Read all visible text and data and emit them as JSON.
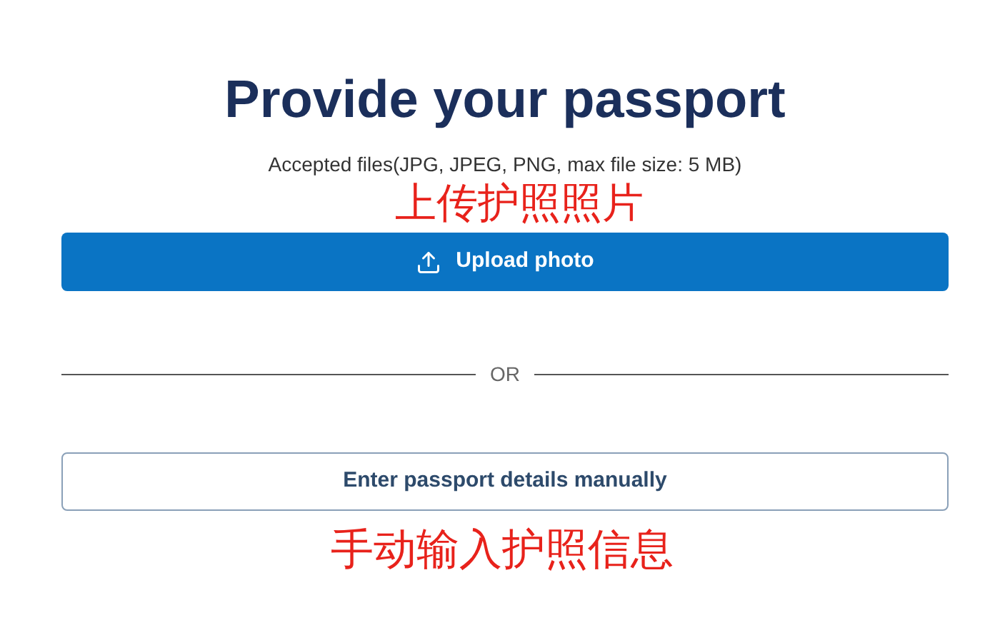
{
  "title": "Provide your passport",
  "subtitle": "Accepted files(JPG, JPEG, PNG, max file size: 5 MB)",
  "annotations": [
    "上传护照照片",
    "手动输入护照信息"
  ],
  "upload_button": {
    "label": "Upload photo"
  },
  "divider": {
    "label": "OR"
  },
  "manual_button": {
    "label": "Enter passport details manually"
  }
}
